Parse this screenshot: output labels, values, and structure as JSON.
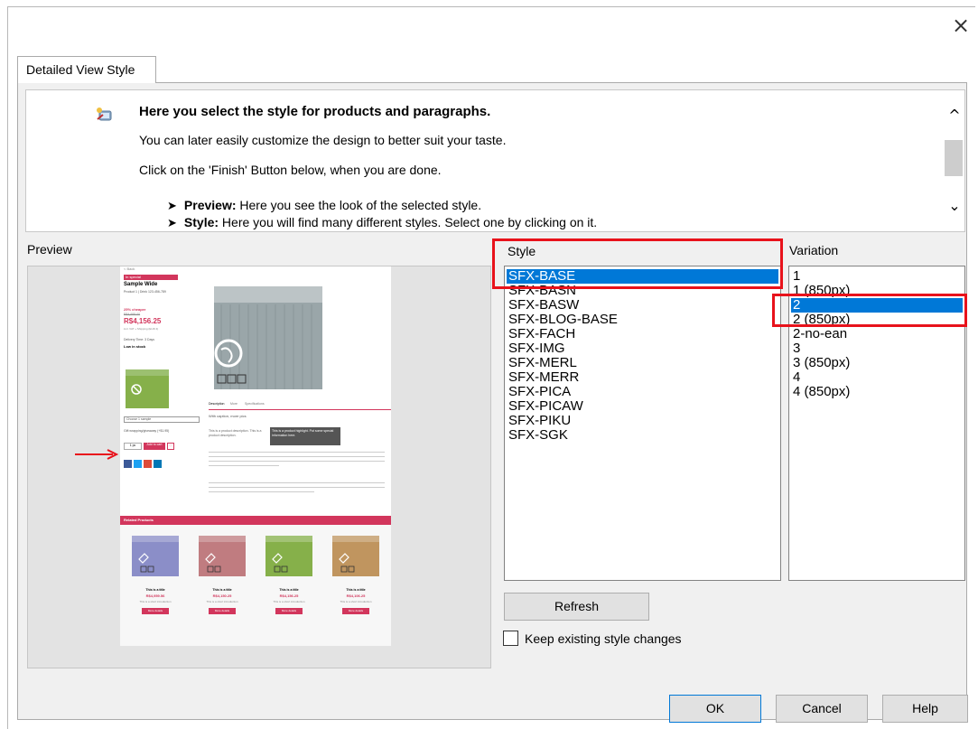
{
  "dialog": {
    "close_symbol": "×",
    "tab_label": "Detailed View Style"
  },
  "info": {
    "icon": "wizard-icon",
    "title": "Here you select the style for products and paragraphs.",
    "line1": "You can later easily customize the design to better suit your taste.",
    "line2": "Click on the 'Finish' Button below, when you are done.",
    "bullets": [
      {
        "term": "Preview:",
        "text": " Here you see the look of the selected style."
      },
      {
        "term": "Style:",
        "text": " Here you will find many different styles. Select one by clicking on it."
      }
    ],
    "scroll_up_symbol": "^",
    "scroll_down_symbol": "⌄"
  },
  "preview": {
    "label": "Preview",
    "page": {
      "breadcrumb": "< Back",
      "special_tag": "In special",
      "product_title": "Sample Wide",
      "product_sub": "Product 1 | Drink 123-456-789",
      "discount": "25% cheaper",
      "old_price": "R$4,955.00",
      "price": "R$4,156.25",
      "vat_note": "incl. VAT + Shipping (EUR 4)",
      "delivery": "Delivery Time: 3 Days",
      "stock": "Low in stock",
      "select_placeholder": "Choose 1 sample",
      "gift_option": "Gift wrapping/giveaway (+$1.95)",
      "qty_value": "1 pc",
      "add_to_cart": "Add to cart",
      "tabs": [
        "Description",
        "More",
        "Specifications"
      ],
      "caption": "With caption, more pics",
      "highlight": "This is a product highlight. Put some special information here.",
      "desc_text": "This is a product description. This is a product description.",
      "related_title": "Related Products",
      "related_items": [
        {
          "title": "This is a title",
          "price": "R$4,959.56",
          "intro": "This is a short introduction",
          "button": "More details",
          "color": "#8b8ec8"
        },
        {
          "title": "This is a title",
          "price": "R$4,150.25",
          "intro": "This is a short introduction",
          "button": "More details",
          "color": "#c07c80"
        },
        {
          "title": "This is a title",
          "price": "R$4,156.25",
          "intro": "This is a short introduction",
          "button": "More details",
          "color": "#86b04a"
        },
        {
          "title": "This is a title",
          "price": "R$4,106.25",
          "intro": "This is a short introduction",
          "button": "More details",
          "color": "#c0955f"
        }
      ],
      "accent_color": "#d2365c"
    },
    "arrow_color": "#e8121b"
  },
  "style": {
    "label": "Style",
    "items": [
      "SFX-BASE",
      "SFX-BASN",
      "SFX-BASW",
      "SFX-BLOG-BASE",
      "SFX-FACH",
      "SFX-IMG",
      "SFX-MERL",
      "SFX-MERR",
      "SFX-PICA",
      "SFX-PICAW",
      "SFX-PIKU",
      "SFX-SGK"
    ],
    "selected": "SFX-BASE"
  },
  "variation": {
    "label": "Variation",
    "items": [
      "1",
      "1 (850px)",
      "2",
      "2 (850px)",
      "2-no-ean",
      "3",
      "3 (850px)",
      "4",
      "4 (850px)"
    ],
    "selected": "2"
  },
  "buttons": {
    "refresh": "Refresh",
    "ok": "OK",
    "cancel": "Cancel",
    "help": "Help"
  },
  "keep_changes": {
    "label": "Keep existing style changes",
    "checked": false
  },
  "colors": {
    "selection": "#0078d7",
    "highlight_box": "#e8121b"
  }
}
